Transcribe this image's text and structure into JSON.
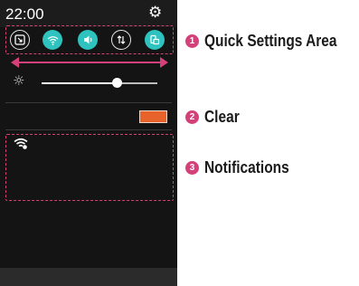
{
  "status_bar": {
    "time": "22:00",
    "settings_icon": "gear-icon"
  },
  "quick_settings": {
    "toggles": [
      {
        "name": "screen-capture-icon",
        "glyph": "⧉",
        "active": false
      },
      {
        "name": "wifi-icon",
        "glyph": "≋",
        "active": true
      },
      {
        "name": "sound-icon",
        "glyph": "◀)",
        "active": true
      },
      {
        "name": "data-icon",
        "glyph": "⇅",
        "active": false
      },
      {
        "name": "rotation-icon",
        "glyph": "⎘",
        "active": true
      }
    ],
    "scroll_arrow_icon": "left-right-arrow-icon"
  },
  "brightness": {
    "icon": "brightness-icon",
    "glyph": "☼",
    "level": 0.65
  },
  "clear_button": {
    "color": "#e8632c"
  },
  "notifications": [
    {
      "icon": "wifi-notification-icon",
      "glyph": "≋"
    }
  ],
  "callouts": [
    {
      "number": "1",
      "label": "Quick Settings Area"
    },
    {
      "number": "2",
      "label": "Clear"
    },
    {
      "number": "3",
      "label": "Notifications"
    }
  ],
  "colors": {
    "accent": "#d4407a",
    "toggle_on": "#2ec3be",
    "panel_background": "#141414"
  }
}
